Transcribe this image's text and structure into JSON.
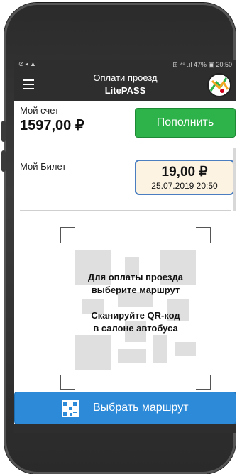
{
  "status_bar": {
    "left_icons": "⊘◂▲",
    "right_text": "⊞ ⁴⁹ .ıl 47% ▣ 20:50"
  },
  "header": {
    "title": "Оплати проезд",
    "subtitle": "LitePASS"
  },
  "account": {
    "label": "Мой счет",
    "balance": "1597,00 ₽",
    "topup_label": "Пополнить"
  },
  "ticket": {
    "label": "Мой Билет",
    "price": "19,00 ₽",
    "datetime": "25.07.2019 20:50"
  },
  "scan": {
    "line1": "Для оплаты проезда",
    "line2": "выберите маршрут",
    "line3": "Сканируйте QR-код",
    "line4": "в салоне автобуса"
  },
  "route_button": {
    "label": "Выбрать маршрут"
  },
  "colors": {
    "topup_green": "#2db34a",
    "route_blue": "#2c8ad8",
    "ticket_bg": "#fcf3e3",
    "ticket_border": "#4a7ec1",
    "header_bg": "#2e2e2e"
  }
}
